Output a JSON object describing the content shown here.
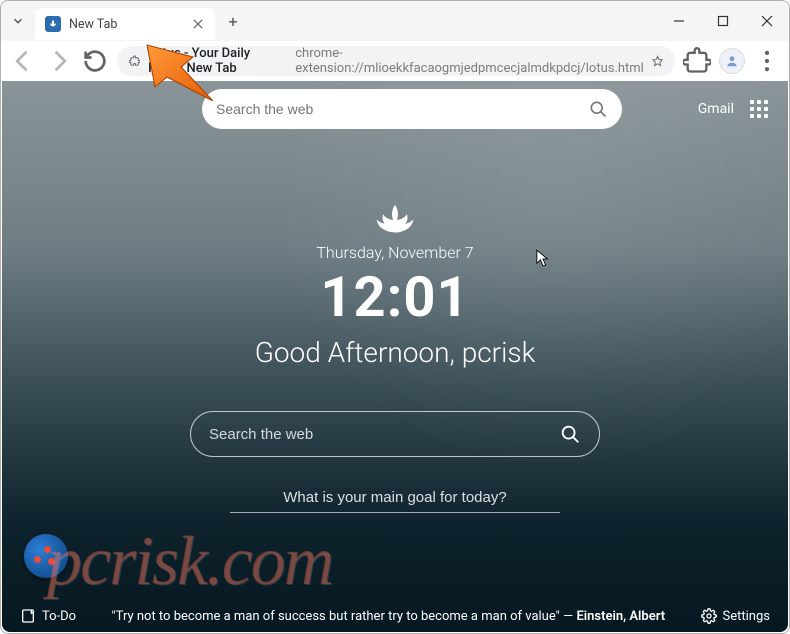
{
  "window": {
    "tab_title": "New Tab",
    "controls": {
      "minimize": "–",
      "maximize": "□",
      "close": "×"
    }
  },
  "urlbar": {
    "site_title": "Lotus - Your Daily Focus New Tab",
    "url": "chrome-extension://mlioekkfacaogmjedpmcecjalmdkpdcj/lotus.html"
  },
  "top": {
    "search_placeholder": "Search the web",
    "gmail": "Gmail"
  },
  "center": {
    "date": "Thursday, November 7",
    "time": "12:01",
    "greeting": "Good Afternoon, pcrisk",
    "search_placeholder": "Search the web",
    "goal_placeholder": "What is your main goal for today?"
  },
  "bottom": {
    "todo": "To-Do",
    "quote_text": "\"Try not to become a man of success but rather try to become a man of value\" —",
    "quote_author": "Einstein, Albert",
    "settings": "Settings"
  },
  "watermark": "pcrisk.com"
}
